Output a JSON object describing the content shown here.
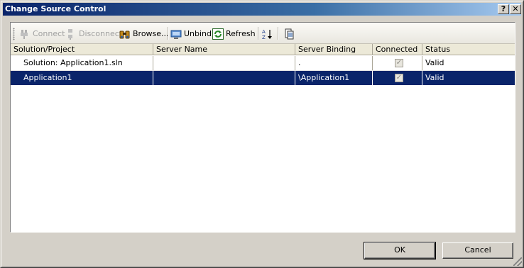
{
  "window": {
    "title": "Change Source Control",
    "help_label": "?",
    "close_label": "✕"
  },
  "toolbar": {
    "connect": "Connect",
    "disconnect": "Disconnect",
    "browse": "Browse...",
    "unbind": "Unbind",
    "refresh": "Refresh",
    "sort_label": "A↓Z",
    "icons": {
      "connect": "plug-icon",
      "disconnect": "unplug-icon",
      "browse": "binoculars-icon",
      "unbind": "unbind-icon",
      "refresh": "refresh-icon",
      "sort": "sort-icon",
      "properties": "properties-icon"
    }
  },
  "grid": {
    "columns": [
      "Solution/Project",
      "Server Name",
      "Server Binding",
      "Connected",
      "Status"
    ],
    "rows": [
      {
        "name": "Solution: Application1.sln",
        "server": "",
        "binding": ".",
        "connected": true,
        "status": "Valid"
      },
      {
        "name": "Application1",
        "server": "",
        "binding": "\\Application1",
        "connected": true,
        "status": "Valid"
      }
    ],
    "selected_row": 1
  },
  "buttons": {
    "ok": "OK",
    "cancel": "Cancel"
  },
  "colors": {
    "selection": "#0a246a",
    "title_bar": "#0a246a",
    "face": "#d4d0c8"
  }
}
